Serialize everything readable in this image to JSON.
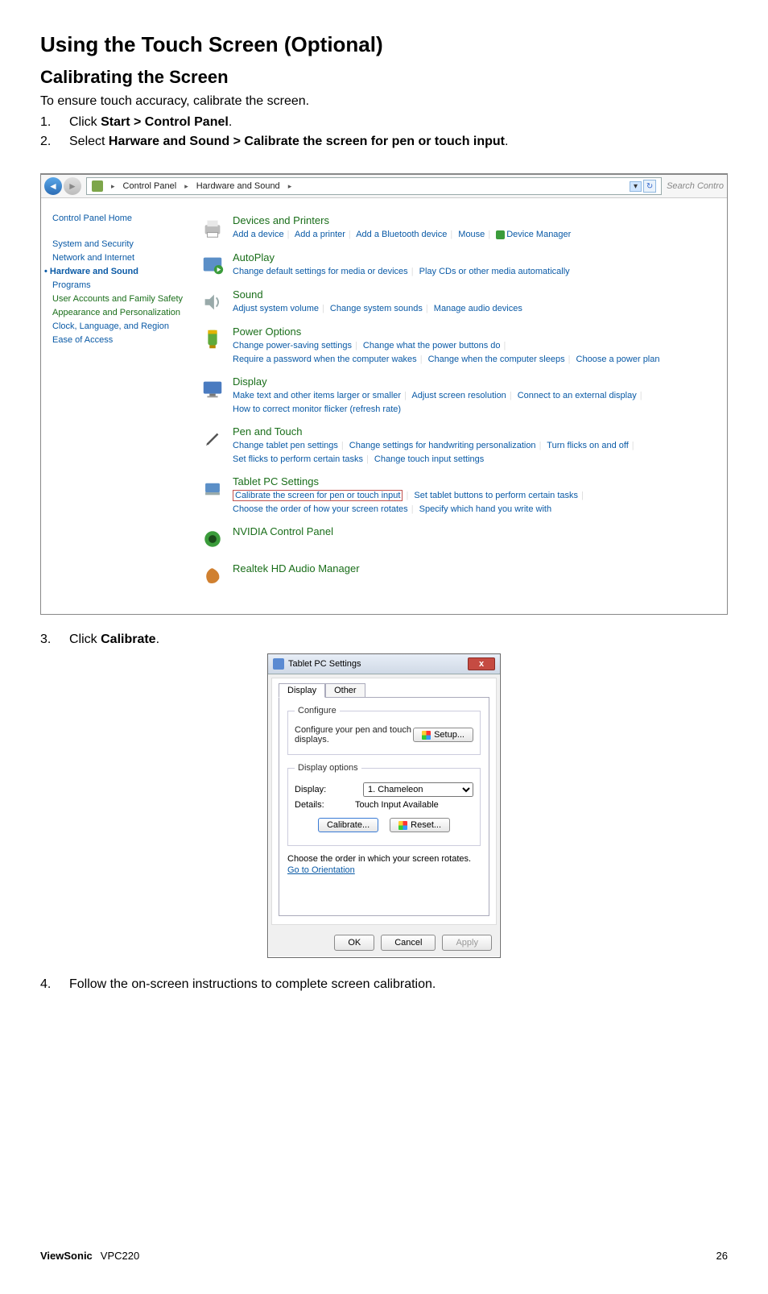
{
  "heading": "Using the Touch Screen (Optional)",
  "subheading": "Calibrating the Screen",
  "intro": "To ensure touch accuracy, calibrate the screen.",
  "steps": [
    {
      "num": "1.",
      "pre": "Click ",
      "bold": "Start > Control Panel",
      "post": "."
    },
    {
      "num": "2.",
      "pre": "Select ",
      "bold": "Harware and Sound > Calibrate the screen for pen or touch input",
      "post": "."
    }
  ],
  "cp": {
    "breadcrumb": {
      "root": "Control Panel",
      "sub": "Hardware and Sound"
    },
    "search_hint": "Search Contro",
    "side": {
      "home": "Control Panel Home",
      "items": [
        "System and Security",
        "Network and Internet",
        "Hardware and Sound",
        "Programs",
        "User Accounts and Family Safety",
        "Appearance and Personalization",
        "Clock, Language, and Region",
        "Ease of Access"
      ],
      "active_index": 2
    },
    "cats": {
      "devices": {
        "title": "Devices and Printers",
        "links": [
          "Add a device",
          "Add a printer",
          "Add a Bluetooth device",
          "Mouse",
          "Device Manager"
        ]
      },
      "autoplay": {
        "title": "AutoPlay",
        "links": [
          "Change default settings for media or devices",
          "Play CDs or other media automatically"
        ]
      },
      "sound": {
        "title": "Sound",
        "links": [
          "Adjust system volume",
          "Change system sounds",
          "Manage audio devices"
        ]
      },
      "power": {
        "title": "Power Options",
        "links": [
          "Change power-saving settings",
          "Change what the power buttons do",
          "Require a password when the computer wakes",
          "Change when the computer sleeps",
          "Choose a power plan"
        ]
      },
      "display": {
        "title": "Display",
        "links": [
          "Make text and other items larger or smaller",
          "Adjust screen resolution",
          "Connect to an external display",
          "How to correct monitor flicker (refresh rate)"
        ]
      },
      "pen": {
        "title": "Pen and Touch",
        "links": [
          "Change tablet pen settings",
          "Change settings for handwriting personalization",
          "Turn flicks on and off",
          "Set flicks to perform certain tasks",
          "Change touch input settings"
        ]
      },
      "tablet": {
        "title": "Tablet PC Settings",
        "links": [
          "Calibrate the screen for pen or touch input",
          "Set tablet buttons to perform certain tasks",
          "Choose the order of how your screen rotates",
          "Specify which hand you write with"
        ],
        "boxed_index": 0
      },
      "nvidia": {
        "title": "NVIDIA Control Panel"
      },
      "realtek": {
        "title": "Realtek HD Audio Manager"
      }
    }
  },
  "step3": {
    "num": "3.",
    "pre": "Click ",
    "bold": "Calibrate",
    "post": "."
  },
  "dlg": {
    "title": "Tablet PC Settings",
    "tabs": {
      "display": "Display",
      "other": "Other"
    },
    "configure": {
      "legend": "Configure",
      "text": "Configure your pen and touch displays.",
      "setup": "Setup..."
    },
    "display_opts": {
      "legend": "Display options",
      "display_label": "Display:",
      "display_value": "1. Chameleon",
      "details_label": "Details:",
      "details_value": "Touch Input Available",
      "calibrate": "Calibrate...",
      "reset": "Reset..."
    },
    "orientation": {
      "text": "Choose the order in which your screen rotates.",
      "link": "Go to Orientation"
    },
    "buttons": {
      "ok": "OK",
      "cancel": "Cancel",
      "apply": "Apply"
    }
  },
  "step4": {
    "num": "4.",
    "text": "Follow the on-screen instructions to complete screen calibration."
  },
  "footer": {
    "brand": "ViewSonic",
    "model": "VPC220",
    "page": "26"
  }
}
